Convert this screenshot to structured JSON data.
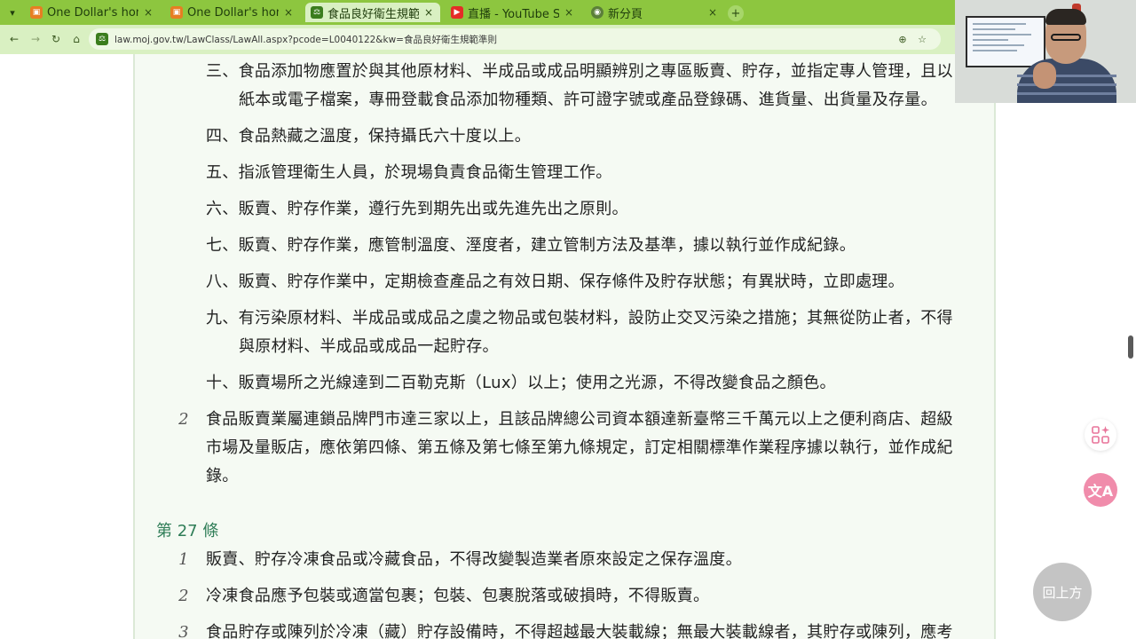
{
  "browser": {
    "tabs": [
      {
        "title": "One Dollar's hom",
        "active": false,
        "favicon": "orange-square-icon"
      },
      {
        "title": "One Dollar's hom",
        "active": false,
        "favicon": "orange-square-icon"
      },
      {
        "title": "食品良好衛生規範",
        "active": true,
        "favicon": "moj-law-icon"
      },
      {
        "title": "直播 - YouTube St",
        "active": false,
        "favicon": "youtube-icon"
      },
      {
        "title": "新分頁",
        "active": false,
        "favicon": "chrome-icon"
      }
    ],
    "close_glyph": "×",
    "new_tab_glyph": "+",
    "url": "law.moj.gov.tw/LawClass/LawAll.aspx?pcode=L0040122&kw=食品良好衛生規範準則",
    "colors": {
      "chrome": "#8dc63f",
      "toolbar": "#d9f0c2",
      "article_bg": "#f5faf3",
      "article_heading": "#2f7d57"
    }
  },
  "law": {
    "items": [
      {
        "label": "三、",
        "lines": [
          "食品添加物應置於與其他原材料、半成品或成品明顯辨別之專區販賣、貯存，並指定專人管理，且以",
          "紙本或電子檔案，專冊登載食品添加物種類、許可證字號或產品登錄碼、進貨量、出貨量及存量。"
        ]
      },
      {
        "label": "四、",
        "lines": [
          "食品熱藏之溫度，保持攝氏六十度以上。"
        ]
      },
      {
        "label": "五、",
        "lines": [
          "指派管理衛生人員，於現場負責食品衛生管理工作。"
        ]
      },
      {
        "label": "六、",
        "lines": [
          "販賣、貯存作業，遵行先到期先出或先進先出之原則。"
        ]
      },
      {
        "label": "七、",
        "lines": [
          "販賣、貯存作業，應管制溫度、溼度者，建立管制方法及基準，據以執行並作成紀錄。"
        ]
      },
      {
        "label": "八、",
        "lines": [
          "販賣、貯存作業中，定期檢查產品之有效日期、保存條件及貯存狀態；有異狀時，立即處理。"
        ]
      },
      {
        "label": "九、",
        "lines": [
          "有污染原材料、半成品或成品之虞之物品或包裝材料，設防止交叉污染之措施；其無從防止者，不得",
          "與原材料、半成品或成品一起貯存。"
        ]
      },
      {
        "label": "十、",
        "lines": [
          "販賣場所之光線達到二百勒克斯（Lux）以上；使用之光源，不得改變食品之顏色。"
        ]
      }
    ],
    "paragraph_2": {
      "num": "2",
      "lines": [
        "食品販賣業屬連鎖品牌門市達三家以上，且該品牌總公司資本額達新臺幣三千萬元以上之便利商店、超級",
        "市場及量販店，應依第四條、第五條及第七條至第九條規定，訂定相關標準作業程序據以執行，並作成紀",
        "錄。"
      ]
    },
    "article_27": {
      "heading": "第 27 條",
      "paragraphs": [
        {
          "num": "1",
          "text": "販賣、貯存冷凍食品或冷藏食品，不得改變製造業者原來設定之保存溫度。"
        },
        {
          "num": "2",
          "text": "冷凍食品應予包裝或適當包裹；包裝、包裹脫落或破損時，不得販賣。"
        },
        {
          "num": "3",
          "text": "食品貯存或陳列於冷凍（藏）貯存設備時，不得超越最大裝載線；無最大裝載線者，其貯存或陳列，應考"
        }
      ]
    }
  },
  "overlay": {
    "back_to_top": "回上方",
    "translate_glyph": "文A",
    "apps_icon": "apps-sparkle-icon"
  }
}
